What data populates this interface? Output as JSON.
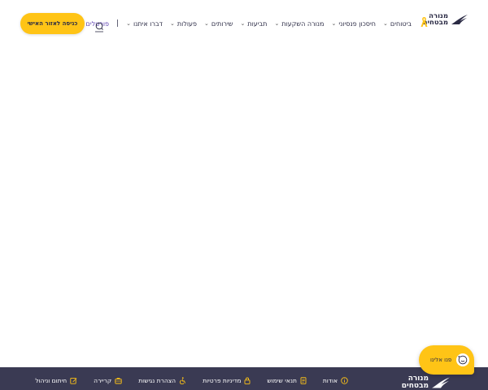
{
  "header": {
    "logo_line1": "מנורה",
    "logo_line2": "מבטחים",
    "nav": [
      {
        "label": "ביטוחים"
      },
      {
        "label": "חיסכון פנסיוני"
      },
      {
        "label": "מנורה השקעות"
      },
      {
        "label": "תביעות"
      },
      {
        "label": "שירותים"
      },
      {
        "label": "פעולות"
      },
      {
        "label": "דברו איתנו"
      },
      {
        "label": "פורטלים"
      }
    ],
    "separator": "|",
    "search_icon": "search-icon",
    "cta_label": "כניסה לאזור האישי"
  },
  "footer": {
    "logo_line1": "מנורה",
    "logo_line2": "מבטחים",
    "links": [
      {
        "label": "אודות",
        "icon": "info-icon"
      },
      {
        "label": "תנאי שימוש",
        "icon": "document-icon"
      },
      {
        "label": "מדיניות פרטיות",
        "icon": "lock-icon"
      },
      {
        "label": "הצהרת נגישות",
        "icon": "accessibility-icon"
      },
      {
        "label": "קריירה",
        "icon": "briefcase-icon"
      },
      {
        "label": "חיתום וניהול",
        "icon": "edit-icon"
      }
    ]
  },
  "chat": {
    "label": "פנו אלינו",
    "icon": "chat-smile-icon"
  },
  "colors": {
    "accent_yellow": "#ffc416",
    "footer_bg": "#3a3a53",
    "text_dark": "#2b2b45",
    "accent_purple": "#5b3fb0"
  }
}
